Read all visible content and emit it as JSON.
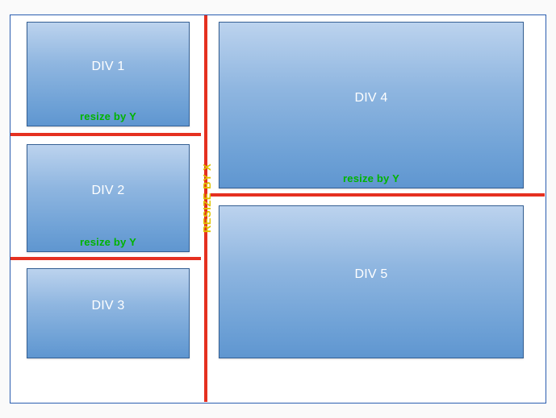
{
  "boxes": {
    "div1": {
      "title": "DIV 1",
      "resize": "resize by Y"
    },
    "div2": {
      "title": "DIV 2",
      "resize": "resize by Y"
    },
    "div3": {
      "title": "DIV 3"
    },
    "div4": {
      "title": "DIV 4",
      "resize": "resize by Y"
    },
    "div5": {
      "title": "DIV 5"
    }
  },
  "separators": {
    "vertical_label": "RESIZE BY X"
  }
}
